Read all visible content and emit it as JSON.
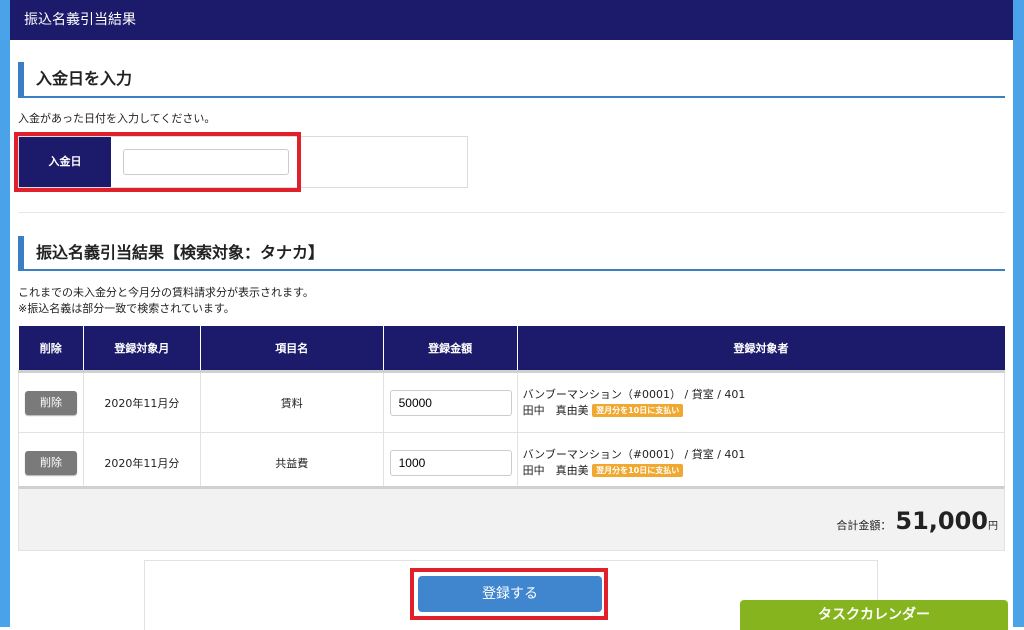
{
  "window": {
    "title": "振込名義引当結果"
  },
  "date_section": {
    "heading": "入金日を入力",
    "description": "入金があった日付を入力してください。",
    "field_label": "入金日",
    "field_value": ""
  },
  "results_section": {
    "heading": "振込名義引当結果【検索対象：タナカ】",
    "description_1": "これまでの未入金分と今月分の賃料請求分が表示されます。",
    "description_2": "※振込名義は部分一致で検索されています。"
  },
  "table": {
    "columns": [
      "削除",
      "登録対象月",
      "項目名",
      "登録金額",
      "登録対象者"
    ],
    "rows": [
      {
        "delete_label": "削除",
        "month": "2020年11月分",
        "item": "賃料",
        "amount": "50000",
        "target_line1": "バンブーマンション（#0001） / 貸室 / 401",
        "target_name": "田中　真由美",
        "target_badge": "翌月分を10日に支払い"
      },
      {
        "delete_label": "削除",
        "month": "2020年11月分",
        "item": "共益費",
        "amount": "1000",
        "target_line1": "バンブーマンション（#0001） / 貸室 / 401",
        "target_name": "田中　真由美",
        "target_badge": "翌月分を10日に支払い"
      }
    ]
  },
  "total": {
    "label": "合計金額：",
    "value": "51,000",
    "unit": "円"
  },
  "actions": {
    "submit_label": "登録する",
    "task_calendar_label": "タスクカレンダー"
  },
  "colors": {
    "navy": "#1c1a6b",
    "accent_blue": "#3a7fc4",
    "button_blue": "#3f86cf",
    "highlight_red": "#e0202a",
    "badge_orange": "#f0a830",
    "tab_green": "#86b41e",
    "frame_blue": "#4aa3e8"
  }
}
